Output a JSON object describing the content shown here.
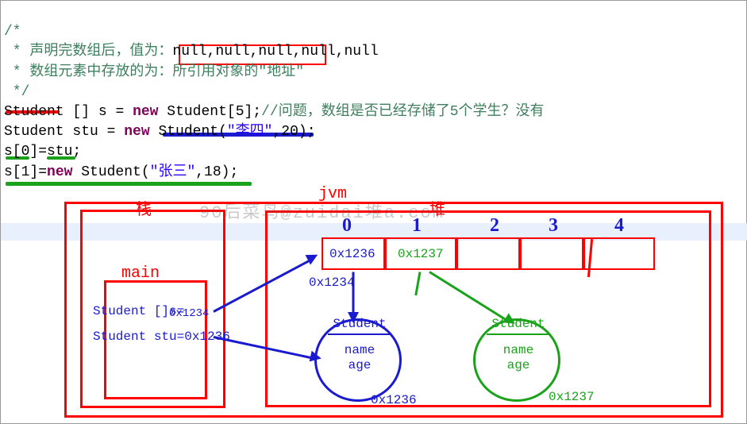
{
  "code": {
    "c1": "/*",
    "c2": " * 声明完数组后，值为：",
    "c2b": "null,null,null,null,null",
    "c3": " * 数组元素中存放的为：",
    "c3b": "所引用对象的\"地址\"",
    "c4": " */",
    "l5_type": "Student",
    "l5_brackets": " [] ",
    "l5_var": "s",
    "l5_eq": " = ",
    "l5_new": "new",
    "l5_ctor": " Student[",
    "l5_num": "5",
    "l5_end": "];",
    "l5_cmt": "//问题，数组是否已经存储了5个学生？没有",
    "l6_type": "Student",
    "l6_var": " stu ",
    "l6_eq": "= ",
    "l6_new": "new",
    "l6_ctor": " Student(",
    "l6_str": "\"李四\"",
    "l6_rest": ",20);",
    "l7": "s[0]=stu;",
    "l8a": "s[1]=",
    "l8_new": "new",
    "l8b": " Student(",
    "l8_str": "\"张三\"",
    "l8c": ",18);"
  },
  "labels": {
    "jvm": "jvm",
    "stack": "栈",
    "main": "main",
    "heap": "堆",
    "idx0": "0",
    "idx1": "1",
    "idx2": "2",
    "idx3": "3",
    "idx4": "4",
    "cell0": "0x1236",
    "cell1": "0x1237",
    "arrAddr": "0x1234",
    "stackLine1": "Student []s=",
    "stackAddr1": "0x1234",
    "stackLine2": "Student stu=0x1236",
    "stu1": "Student",
    "stu1_name": "name",
    "stu1_age": "age",
    "stu1_addr": "0x1236",
    "stu2": "Student",
    "stu2_name": "name",
    "stu2_age": "age",
    "stu2_addr": "0x1237"
  },
  "wm": "90后菜鸟@zuidai堆a.com",
  "chart_data": {
    "type": "diagram",
    "description": "JVM memory model: stack frame 'main' holds reference variables s (0x1234) and stu (0x1236). Heap contains Student[5] array at 0x1234 whose slots 0 and 1 hold addresses 0x1236 and 0x1237 pointing to two Student objects (name, age).",
    "stack": {
      "frame": "main",
      "vars": [
        {
          "decl": "Student[] s",
          "value": "0x1234"
        },
        {
          "decl": "Student stu",
          "value": "0x1236"
        }
      ]
    },
    "heap": {
      "array": {
        "address": "0x1234",
        "length": 5,
        "slots": [
          "0x1236",
          "0x1237",
          null,
          null,
          null
        ]
      },
      "objects": [
        {
          "type": "Student",
          "address": "0x1236",
          "fields": [
            "name",
            "age"
          ]
        },
        {
          "type": "Student",
          "address": "0x1237",
          "fields": [
            "name",
            "age"
          ]
        }
      ]
    },
    "pointers": [
      {
        "from": "s",
        "to": "array@0x1234"
      },
      {
        "from": "stu",
        "to": "Student@0x1236"
      },
      {
        "from": "array[0]",
        "to": "Student@0x1236"
      },
      {
        "from": "array[1]",
        "to": "Student@0x1237"
      }
    ]
  }
}
